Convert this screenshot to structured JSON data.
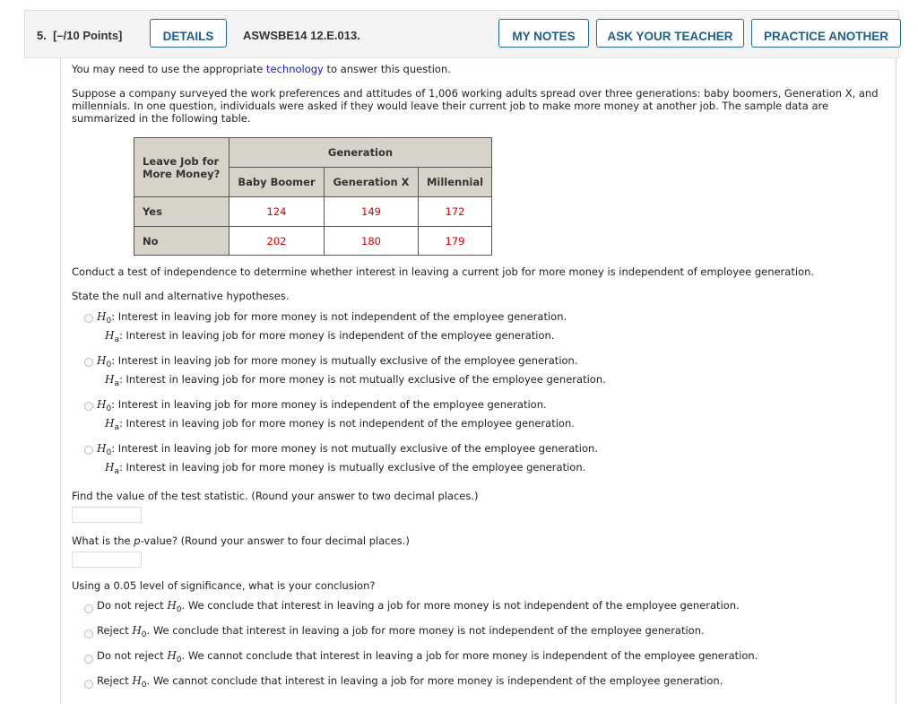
{
  "header": {
    "question_number": "5.",
    "points": "[–/10 Points]",
    "details_label": "DETAILS",
    "question_code": "ASWSBE14 12.E.013.",
    "my_notes_label": "MY NOTES",
    "ask_teacher_label": "ASK YOUR TEACHER",
    "practice_another_label": "PRACTICE ANOTHER"
  },
  "intro": {
    "tech_prefix": "You may need to use the appropriate ",
    "tech_link": "technology",
    "tech_suffix": " to answer this question.",
    "scenario": "Suppose a company surveyed the work preferences and attitudes of 1,006 working adults spread over three generations: baby boomers, Generation X, and millennials. In one question, individuals were asked if they would leave their current job to make more money at another job. The sample data are summarized in the following table."
  },
  "table": {
    "row_header": "Leave Job for More Money?",
    "group_header": "Generation",
    "columns": [
      "Baby Boomer",
      "Generation X",
      "Millennial"
    ],
    "rows": [
      {
        "label": "Yes",
        "values": [
          "124",
          "149",
          "172"
        ]
      },
      {
        "label": "No",
        "values": [
          "202",
          "180",
          "179"
        ]
      }
    ]
  },
  "task": "Conduct a test of independence to determine whether interest in leaving a current job for more money is independent of employee generation.",
  "hypotheses": {
    "prompt": "State the null and alternative hypotheses.",
    "h0_symbol": "H",
    "h0_sub": "0",
    "ha_sub": "a",
    "options": [
      {
        "h0": ": Interest in leaving job for more money is not independent of the employee generation.",
        "ha": ": Interest in leaving job for more money is independent of the employee generation."
      },
      {
        "h0": ": Interest in leaving job for more money is mutually exclusive of the employee generation.",
        "ha": ": Interest in leaving job for more money is not mutually exclusive of the employee generation."
      },
      {
        "h0": ": Interest in leaving job for more money is independent of the employee generation.",
        "ha": ": Interest in leaving job for more money is not independent of the employee generation."
      },
      {
        "h0": ": Interest in leaving job for more money is not mutually exclusive of the employee generation.",
        "ha": ": Interest in leaving job for more money is mutually exclusive of the employee generation."
      }
    ]
  },
  "test_statistic": {
    "prompt": "Find the value of the test statistic. (Round your answer to two decimal places.)",
    "value": ""
  },
  "p_value": {
    "prompt_prefix": "What is the ",
    "prompt_italic": "p",
    "prompt_suffix": "-value? (Round your answer to four decimal places.)",
    "value": ""
  },
  "conclusion": {
    "prompt": "Using a 0.05 level of significance, what is your conclusion?",
    "options": [
      {
        "prefix": "Do not reject ",
        "suffix": ". We conclude that interest in leaving a job for more money is not independent of the employee generation."
      },
      {
        "prefix": "Reject ",
        "suffix": ". We conclude that interest in leaving a job for more money is not independent of the employee generation."
      },
      {
        "prefix": "Do not reject ",
        "suffix": ". We cannot conclude that interest in leaving a job for more money is independent of the employee generation."
      },
      {
        "prefix": "Reject ",
        "suffix": ". We cannot conclude that interest in leaving a job for more money is independent of the employee generation."
      }
    ]
  }
}
